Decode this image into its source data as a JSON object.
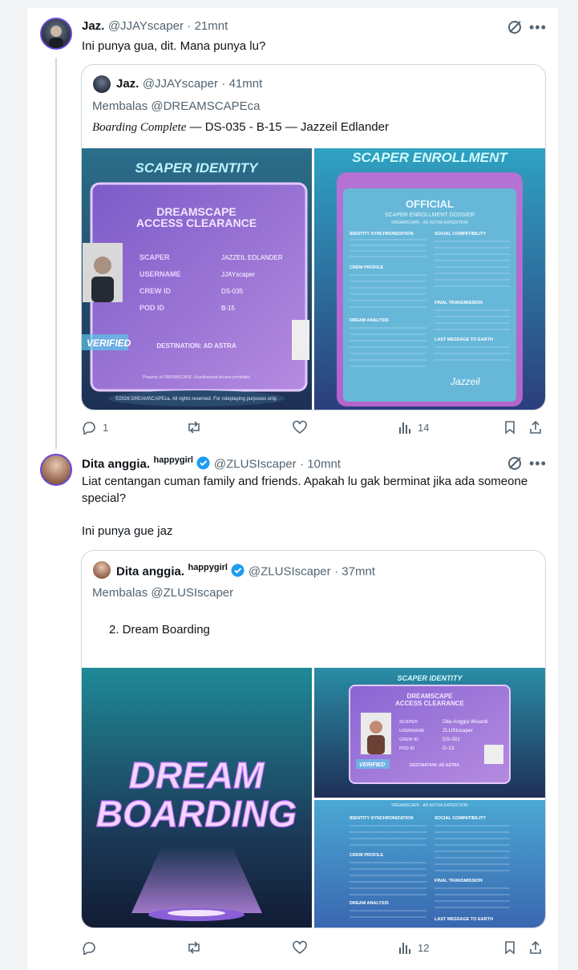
{
  "tweet1": {
    "name": "Jaz.",
    "handle": "@JJAYscaper",
    "time": "· 21mnt",
    "text": "Ini punya gua, dit. Mana punya lu?",
    "quote": {
      "name": "Jaz.",
      "handle": "@JJAYscaper",
      "time": "· 41mnt",
      "reply_to": "Membalas @DREAMSCAPEca",
      "title_italic": "Boarding Complete",
      "title_rest": " — DS-035 - B-15 — Jazzeil Edlander",
      "img1": {
        "header": "SCAPER IDENTITY",
        "line1": "DREAMSCAPE",
        "line2": "ACCESS CLEARANCE",
        "fields": [
          {
            "label": "SCAPER",
            "value": "JAZZEIL EDLANDER"
          },
          {
            "label": "USERNAME",
            "value": "JJAYscaper"
          },
          {
            "label": "CREW ID",
            "value": "DS-035"
          },
          {
            "label": "POD ID",
            "value": "B-15"
          }
        ],
        "verified": "VERIFIED",
        "destination": "DESTINATION: AD ASTRA",
        "property": "Property of DREAMSCAPE. Unauthorized access prohibited",
        "copyright": "©2026 DREAMSCAPEca. All rights reserved. For roleplaying purposes only."
      },
      "img2": {
        "header": "SCAPER ENROLLMENT",
        "official": "OFFICIAL",
        "dossier": "SCAPER ENROLLMENT DOSSIER",
        "sub": "DREAMSCAPE - AD ASTRA EXPEDITION",
        "sections": [
          "IDENTITY SYNCHRONIZATION",
          "CREW PROFILE",
          "DREAM ANALYSIS",
          "SOCIAL COMPATIBILITY",
          "FINAL TRANSMISSION",
          "LAST MESSAGE TO EARTH"
        ],
        "signature": "Jazzeil"
      }
    },
    "actions": {
      "replies": "1",
      "retweets": "",
      "likes": "",
      "views": "14"
    }
  },
  "tweet2": {
    "name": "Dita anggia.",
    "badge": "happygirl",
    "handle": "@ZLUSIscaper",
    "time": "· 10mnt",
    "text1": "Liat centangan cuman family and friends. Apakah lu gak berminat jika ada someone special?",
    "text2": "Ini punya gue jaz",
    "quote": {
      "name": "Dita anggia.",
      "badge": "happygirl",
      "handle": "@ZLUSIscaper",
      "time": "· 37mnt",
      "reply_to": "Membalas @ZLUSIscaper",
      "body": "2. Dream Boarding",
      "img1": {
        "line1": "DREAM",
        "line2": "BOARDING"
      },
      "img2": {
        "header": "SCAPER IDENTITY",
        "line1": "DREAMSCAPE",
        "line2": "ACCESS CLEARANCE",
        "fields": [
          {
            "label": "SCAPER",
            "value": "Dita Anggia Wisanti"
          },
          {
            "label": "USERNAME",
            "value": "ZLUSIscaper"
          },
          {
            "label": "CREW ID",
            "value": "DS-001"
          },
          {
            "label": "POD ID",
            "value": "G-13"
          }
        ],
        "verified": "VERIFIED",
        "destination": "DESTINATION: AD ASTRA"
      },
      "img3": {
        "sub": "DREAMSCAPE - AD ASTRA EXPEDITION",
        "sections": [
          "IDENTITY SYNCHRONIZATION",
          "CREW PROFILE",
          "DREAM ANALYSIS",
          "SOCIAL COMPATIBILITY",
          "FINAL TRANSMISSION",
          "LAST MESSAGE TO EARTH"
        ]
      }
    },
    "actions": {
      "replies": "",
      "retweets": "",
      "likes": "",
      "views": "12"
    }
  }
}
